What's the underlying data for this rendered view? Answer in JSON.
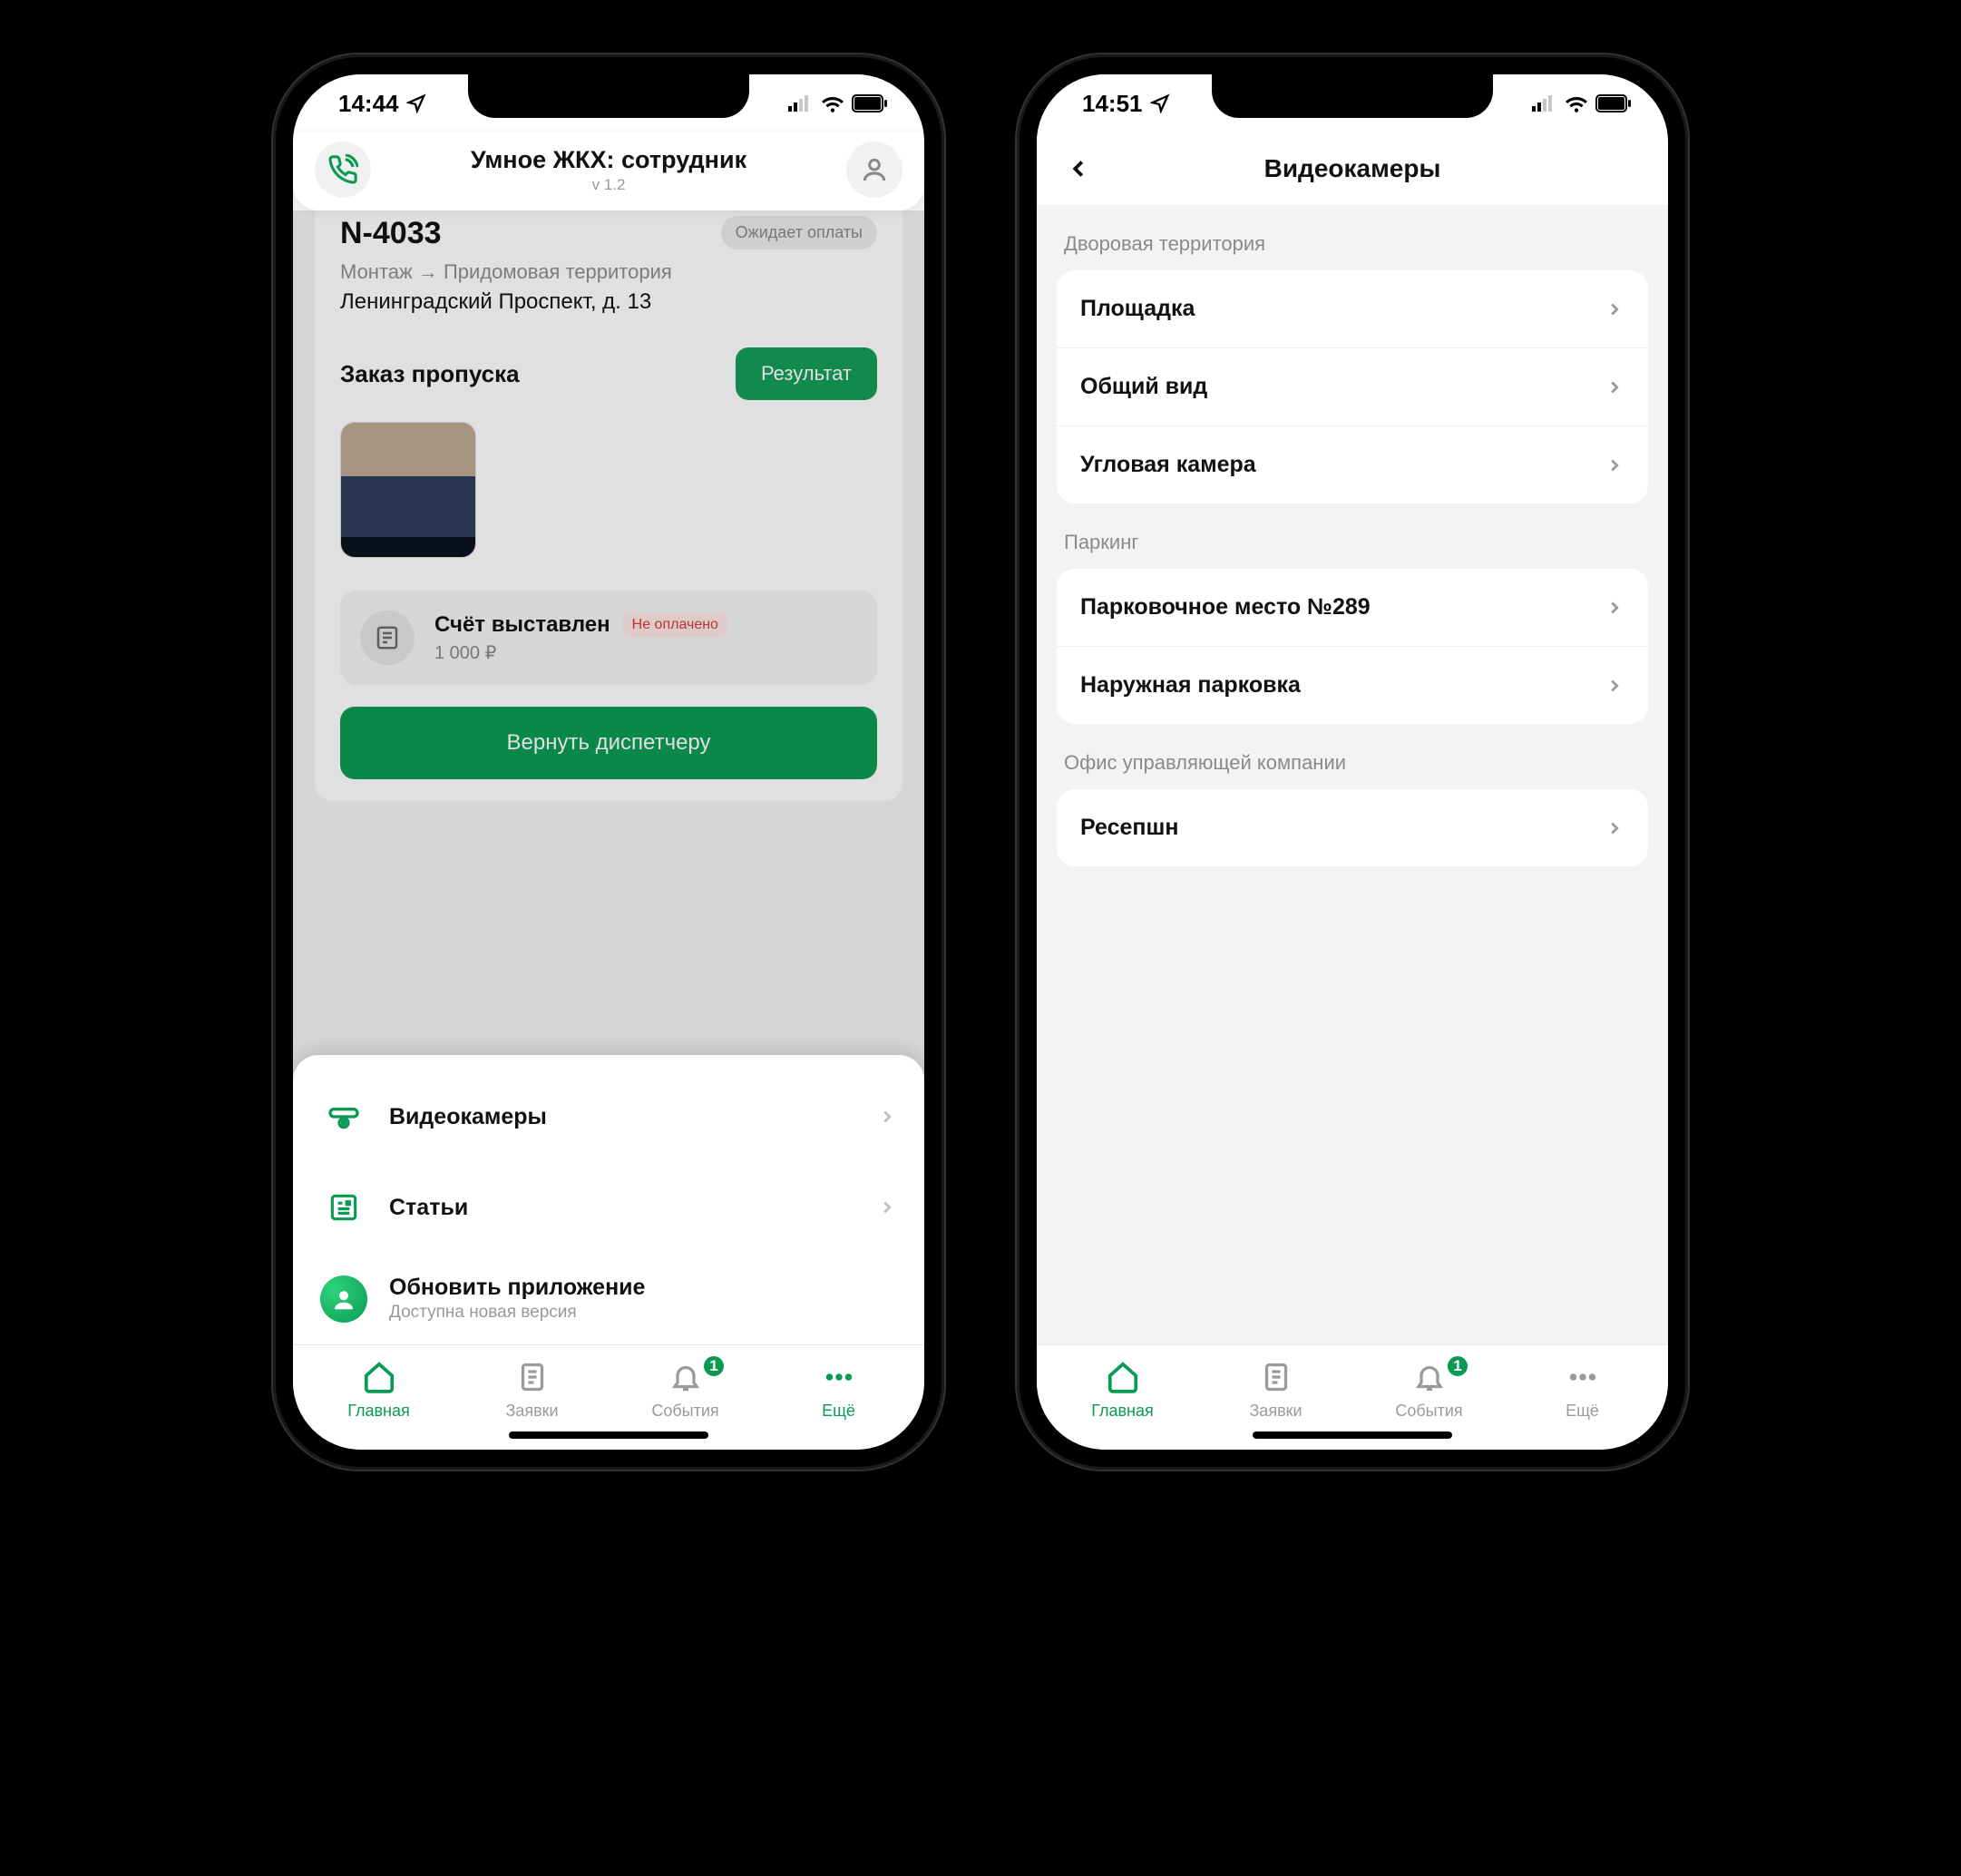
{
  "colors": {
    "accent": "#0a9a53",
    "danger": "#d43b38"
  },
  "screen1": {
    "status": {
      "time": "14:44"
    },
    "header": {
      "title": "Умное ЖКХ: сотрудник",
      "version": "v 1.2"
    },
    "card": {
      "number_partial": "N-4033",
      "status_chip": "Ожидает оплаты",
      "breadcrumb_a": "Монтаж",
      "breadcrumb_b": "Придомовая территория",
      "address": "Ленинградский Проспект, д. 13",
      "pass_label": "Заказ пропуска",
      "result_btn": "Результат",
      "invoice": {
        "title": "Счёт выставлен",
        "badge": "Не оплачено",
        "amount": "1 000 ₽"
      },
      "dispatcher_btn": "Вернуть диспетчеру"
    },
    "sheet": {
      "items": [
        {
          "title": "Видеокамеры"
        },
        {
          "title": "Статьи"
        },
        {
          "title": "Обновить приложение",
          "sub": "Доступна новая версия"
        }
      ]
    },
    "tabbar": {
      "home": "Главная",
      "requests": "Заявки",
      "events": "События",
      "more": "Ещё",
      "badge": "1"
    }
  },
  "screen2": {
    "status": {
      "time": "14:51"
    },
    "title": "Видеокамеры",
    "sections": [
      {
        "label": "Дворовая территория",
        "items": [
          "Площадка",
          "Общий вид",
          "Угловая камера"
        ]
      },
      {
        "label": "Паркинг",
        "items": [
          "Парковочное место №289",
          "Наружная парковка"
        ]
      },
      {
        "label": "Офис управляющей компании",
        "items": [
          "Ресепшн"
        ]
      }
    ],
    "tabbar": {
      "home": "Главная",
      "requests": "Заявки",
      "events": "События",
      "more": "Ещё",
      "badge": "1"
    }
  }
}
